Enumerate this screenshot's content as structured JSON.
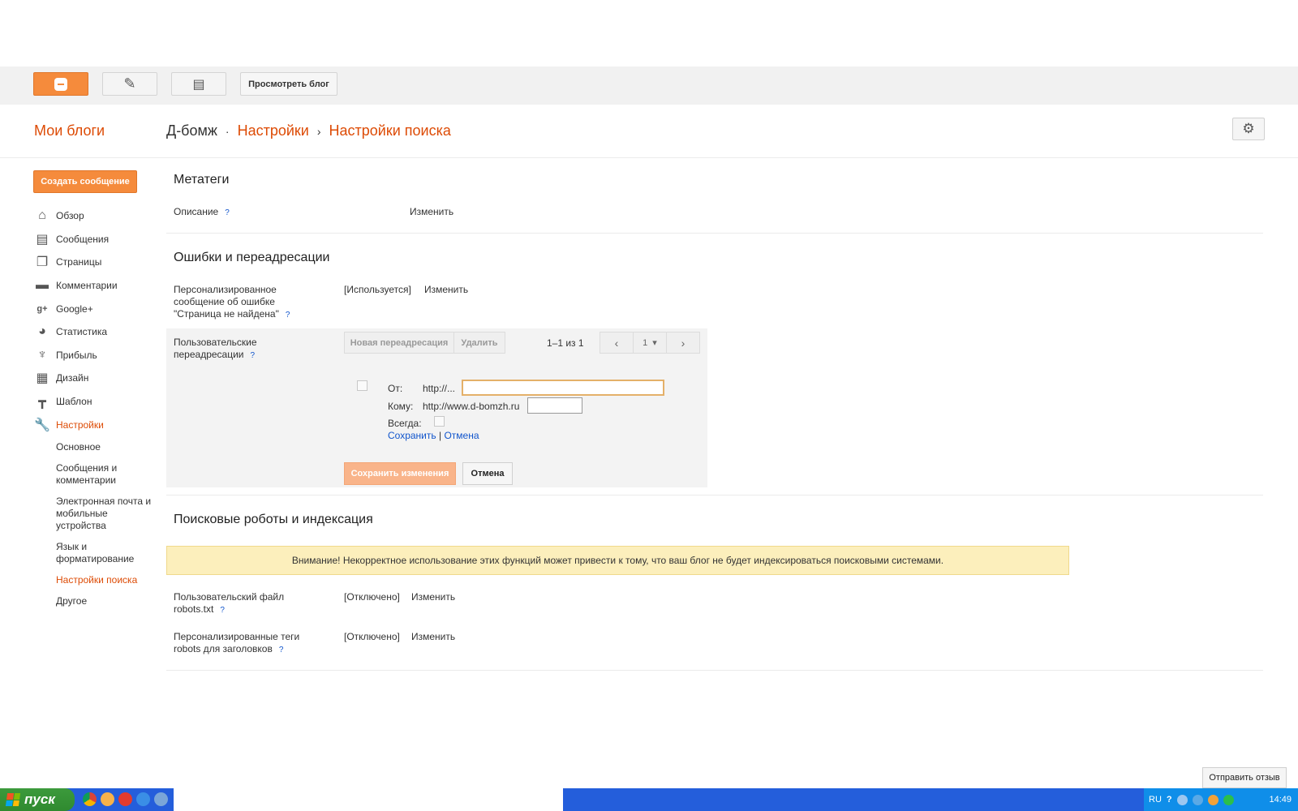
{
  "toolbar": {
    "blogger_icon": "blogger-logo-icon",
    "edit_icon": "pencil-icon",
    "pages_icon": "pages-icon",
    "view_blog_label": "Просмотреть блог"
  },
  "header": {
    "my_blogs": "Мои блоги",
    "blog_name": "Д-бомж",
    "dot": "·",
    "crumb_settings": "Настройки",
    "arrow": "›",
    "crumb_search": "Настройки поиска",
    "gear_icon": "gear-icon"
  },
  "sidebar": {
    "create_post": "Создать сообщение",
    "items": [
      {
        "label": "Обзор",
        "icon": "home-icon"
      },
      {
        "label": "Сообщения",
        "icon": "posts-icon"
      },
      {
        "label": "Страницы",
        "icon": "pages-icon"
      },
      {
        "label": "Комментарии",
        "icon": "comment-icon"
      },
      {
        "label": "Google+",
        "icon": "google-plus-icon"
      },
      {
        "label": "Статистика",
        "icon": "pie-chart-icon"
      },
      {
        "label": "Прибыль",
        "icon": "trophy-icon"
      },
      {
        "label": "Дизайн",
        "icon": "layout-icon"
      },
      {
        "label": "Шаблон",
        "icon": "paint-roller-icon"
      },
      {
        "label": "Настройки",
        "icon": "wrench-icon"
      }
    ],
    "sub_items": [
      "Основное",
      "Сообщения и комментарии",
      "Электронная почта и мобильные устройства",
      "Язык и форматирование",
      "Настройки поиска",
      "Другое"
    ]
  },
  "meta": {
    "title": "Метатеги",
    "description_label": "Описание",
    "help": "?",
    "edit": "Изменить"
  },
  "errors": {
    "title": "Ошибки и переадресации",
    "custom_404_label": "Персонализированное сообщение об ошибке \"Страница не найдена\"",
    "custom_404_value": "[Используется]",
    "edit": "Изменить",
    "redirects_label": "Пользовательские переадресации",
    "new_redirect": "Новая переадресация",
    "delete": "Удалить",
    "pager": "1–1 из 1",
    "page_prev": "‹",
    "page_num": "1",
    "page_caret": "▾",
    "page_next": "›",
    "from_label": "От:",
    "from_prefix": "http://...",
    "from_value": "",
    "to_label": "Кому:",
    "to_prefix": "http://www.d-bomzh.ru",
    "to_value": "",
    "always_label": "Всегда:",
    "save_link": "Сохранить",
    "pipe": "|",
    "cancel_link": "Отмена",
    "save_changes": "Сохранить изменения",
    "cancel": "Отмена"
  },
  "crawlers": {
    "title": "Поисковые роботы и индексация",
    "warning": "Внимание! Некорректное использование этих функций может привести к тому, что ваш блог не будет индексироваться поисковыми системами.",
    "robots_label": "Пользовательский файл robots.txt",
    "robots_value": "[Отключено]",
    "robots_edit": "Изменить",
    "tags_label": "Персонализированные теги robots для заголовков",
    "tags_value": "[Отключено]",
    "tags_edit": "Изменить"
  },
  "feedback": "Отправить отзыв",
  "taskbar": {
    "start": "пуск",
    "lang": "RU",
    "help": "?",
    "clock": "14:49"
  },
  "colors": {
    "accent": "#dd4b05",
    "blogger_orange": "#f58b3c",
    "link": "#1155cc",
    "warning_bg": "#fcefbc",
    "taskbar": "#245edb"
  }
}
